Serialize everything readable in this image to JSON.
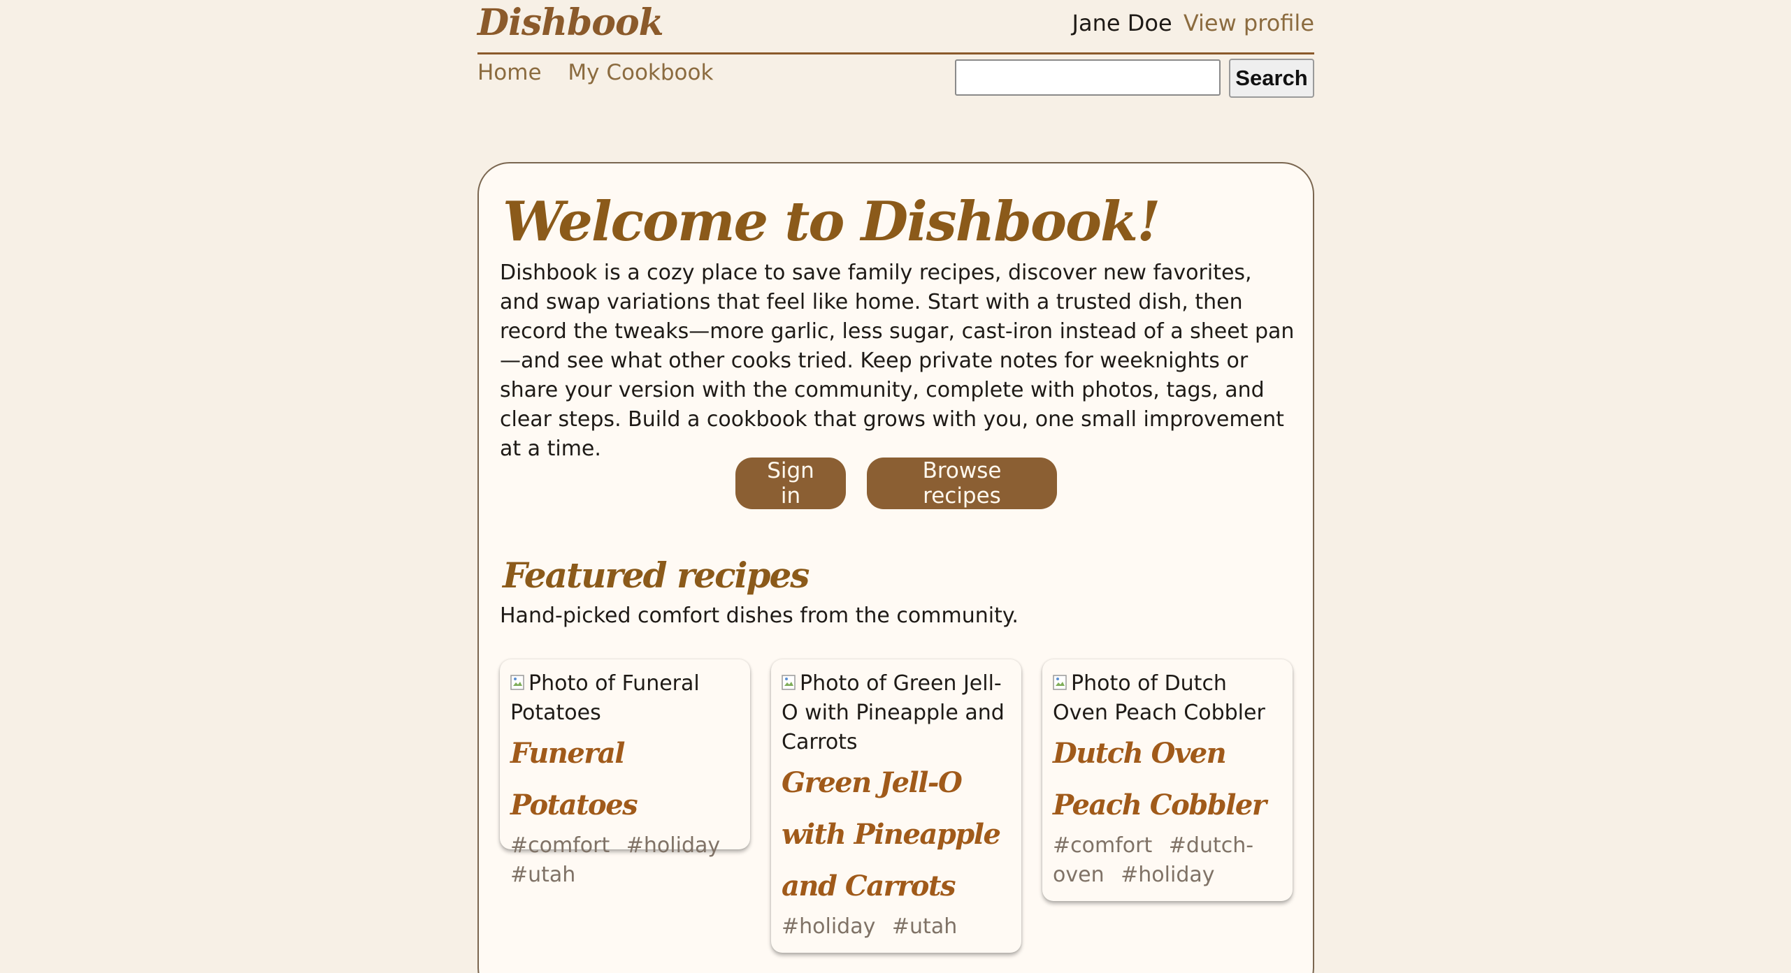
{
  "header": {
    "logo": "Dishbook",
    "user_name": "Jane Doe",
    "view_profile": "View profile"
  },
  "nav": {
    "home": "Home",
    "my_cookbook": "My Cookbook",
    "search_value": "",
    "search_button": "Search"
  },
  "main": {
    "welcome_title": "Welcome to Dishbook!",
    "intro": "Dishbook is a cozy place to save family recipes, discover new favorites, and swap variations that feel like home. Start with a trusted dish, then record the tweaks—more garlic, less sugar, cast-iron instead of a sheet pan—and see what other cooks tried. Keep private notes for weeknights or share your version with the community, complete with photos, tags, and clear steps. Build a cookbook that grows with you, one small improvement at a time.",
    "sign_in": "Sign in",
    "browse_recipes": "Browse recipes",
    "featured_title": "Featured recipes",
    "featured_subtitle": "Hand-picked comfort dishes from the community."
  },
  "recipes": [
    {
      "image_alt": "Photo of Funeral Potatoes",
      "title": "Funeral Potatoes",
      "tags": [
        "#comfort",
        "#holiday",
        "#utah"
      ]
    },
    {
      "image_alt": "Photo of Green Jell-O with Pineapple and Carrots",
      "title": "Green Jell-O with Pineapple and Carrots",
      "tags": [
        "#holiday",
        "#utah"
      ]
    },
    {
      "image_alt": "Photo of Dutch Oven Peach Cobbler",
      "title": "Dutch Oven Peach Cobbler",
      "tags": [
        "#comfort",
        "#dutch-oven",
        "#holiday"
      ]
    }
  ],
  "colors": {
    "background": "#f7f0e6",
    "card": "#fffaf4",
    "accent": "#8b5a2b",
    "button": "#8b5f33",
    "heading": "#8b5a1a",
    "tag": "#7f7266"
  }
}
